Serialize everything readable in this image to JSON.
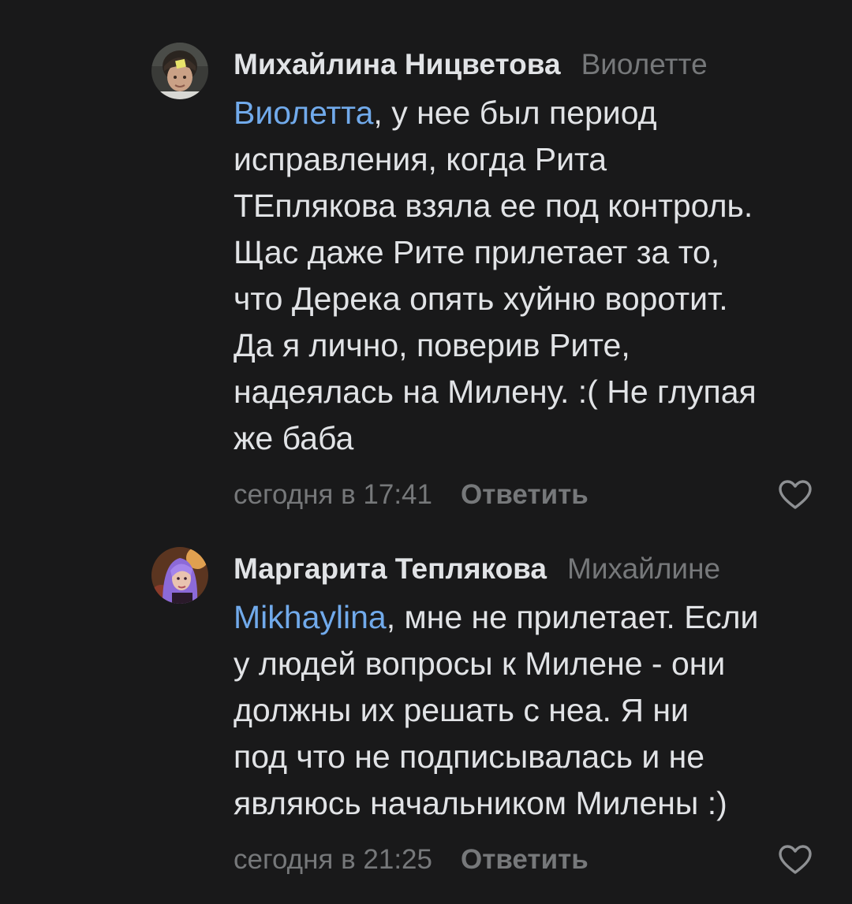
{
  "comments": [
    {
      "author": "Михайлина Ницветова",
      "reply_to": "Виолетте",
      "mention": "Виолетта",
      "text": ", у нее был период\nисправления, когда Рита\nТЕплякова взяла ее под контроль.\nЩас даже Рите прилетает за то,\nчто Дерека опять хуйню воротит.\nДа я лично, поверив Рите,\nнадеялась на Милену. :( Не глупая\nже баба",
      "time": "сегодня в 17:41",
      "reply_label": "Ответить",
      "avatar_icon": "user-photo-avatar",
      "like_icon": "heart-outline-icon"
    },
    {
      "author": "Маргарита Теплякова",
      "reply_to": "Михайлине",
      "mention": "Mikhaylina",
      "text": ", мне не прилетает. Если\nу людей вопросы к Милене - они\nдолжны их решать с неа. Я ни\nпод что не подписывалась и не\nявляюсь начальником Милены :)",
      "time": "сегодня в 21:25",
      "reply_label": "Ответить",
      "avatar_icon": "user-photo-avatar",
      "like_icon": "heart-outline-icon"
    }
  ],
  "colors": {
    "background": "#19191a",
    "text": "#e1e3e6",
    "secondary": "#76787a",
    "mention": "#71aaeb"
  }
}
